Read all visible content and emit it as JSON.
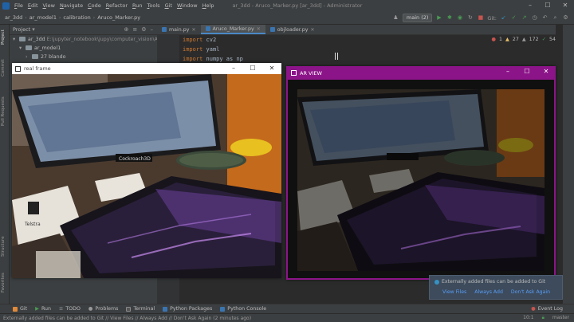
{
  "menubar": {
    "items": [
      "File",
      "Edit",
      "View",
      "Navigate",
      "Code",
      "Refactor",
      "Run",
      "Tools",
      "Git",
      "Window",
      "Help"
    ],
    "window_title": "ar_3dd - Aruco_Marker.py [ar_3dd] - Administrator"
  },
  "navbar": {
    "crumbs": [
      "ar_3dd",
      "ar_model1",
      "calibration",
      "Aruco_Marker.py"
    ],
    "branch": "main (2)",
    "git_label": "Git:"
  },
  "left_stripe": [
    "Project",
    "Commit",
    "Pull Requests",
    "Structure",
    "Favorites"
  ],
  "project": {
    "title": "Project",
    "tree": [
      {
        "label": "ar_3dd",
        "extra": "E:\\jupyter_notebook\\jupy\\computer_vision\\AR\\ar_3dd",
        "indent": 0
      },
      {
        "label": "ar_model1",
        "extra": "",
        "indent": 1
      },
      {
        "label": "27 blando",
        "extra": "",
        "indent": 2
      }
    ]
  },
  "editor": {
    "tabs": [
      {
        "label": "main.py",
        "active": false
      },
      {
        "label": "Aruco_Marker.py",
        "active": true
      },
      {
        "label": "objloader.py",
        "active": false
      }
    ],
    "code": [
      {
        "kw": "import",
        "rest": " cv2"
      },
      {
        "kw": "import",
        "rest": " yaml"
      },
      {
        "kw": "import",
        "rest": " numpy as np"
      }
    ],
    "inspection": {
      "errors": "1",
      "warnings": "27",
      "weak": "172",
      "typos": "54"
    }
  },
  "windows": {
    "real": {
      "title": "real frame"
    },
    "ar": {
      "title": "AR VIEW"
    }
  },
  "scene": {
    "brand": "Cockroach3D",
    "label": "Telstra"
  },
  "bottom_tabs": [
    "Git",
    "Run",
    "TODO",
    "Problems",
    "Terminal",
    "Python Packages",
    "Python Console"
  ],
  "event_log": "Event Log",
  "notification": {
    "text": "Externally added files can be added to Git",
    "actions": [
      "View Files",
      "Always Add",
      "Don't Ask Again"
    ]
  },
  "status": {
    "message": "Externally added files can be added to Git // View Files // Always Add // Don't Ask Again (2 minutes ago)",
    "position": "10:1",
    "branch": "master"
  },
  "colors": {
    "ar_window": "#8c1489",
    "ide_bg": "#2b2b2b",
    "accent": "#4a88c7"
  }
}
